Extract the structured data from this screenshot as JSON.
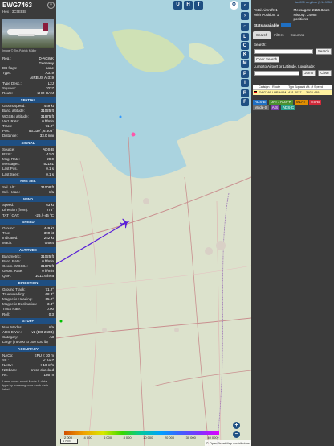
{
  "left_panel": {
    "callsign": "EWG7463",
    "hex_line": "Hex : 3C5EEB",
    "photo_credit": "Image © Tim-Patrick Müller",
    "close_glyph": "×",
    "basics": [
      {
        "k": "Reg.:",
        "v": "D-AGWK"
      },
      {
        "k": "",
        "v": "Germany"
      },
      {
        "k": "DB flags:",
        "v": "none"
      },
      {
        "k": "Type:",
        "v": "A319"
      },
      {
        "k": "",
        "v": "AIRBUS A-319"
      },
      {
        "k": "Type Desc.:",
        "v": "L2J"
      },
      {
        "k": "Squawk:",
        "v": "2037"
      },
      {
        "k": "Route:",
        "v": "LHR-HAM"
      }
    ],
    "spatial_title": "SPATIAL",
    "spatial": [
      {
        "k": "Groundspeed:",
        "v": "449 kt"
      },
      {
        "k": "Baro. altitude:",
        "v": "31025 ft"
      },
      {
        "k": "WGS84 altitude:",
        "v": "31875 ft"
      },
      {
        "k": "Vert. Rate:",
        "v": "0 ft/min"
      },
      {
        "k": "Track:",
        "v": "71.2°"
      },
      {
        "k": "Pos.:",
        "v": "53.330°, 6.808°"
      },
      {
        "k": "Distance:",
        "v": "33.0 nmi"
      }
    ],
    "signal_title": "SIGNAL",
    "signal": [
      {
        "k": "Source:",
        "v": "ADS-B"
      },
      {
        "k": "RSSI:",
        "v": "-11.0"
      },
      {
        "k": "Msg. Rate:",
        "v": "29.0"
      },
      {
        "k": "Messages:",
        "v": "52161"
      },
      {
        "k": "Last Pos.:",
        "v": "0.1 s"
      },
      {
        "k": "Last Seen:",
        "v": "0.1 s"
      }
    ],
    "fms_title": "FMS SEL",
    "fms": [
      {
        "k": "Sel. Alt.:",
        "v": "31008 ft"
      },
      {
        "k": "Sel. Head.:",
        "v": "n/a"
      }
    ],
    "wind_title": "WIND",
    "wind": [
      {
        "k": "Speed:",
        "v": "63 kt"
      },
      {
        "k": "Direction (from):",
        "v": "278°"
      },
      {
        "k": "TAT / OAT:",
        "v": "-26 / -46 °C"
      }
    ],
    "speed_title": "SPEED",
    "speed": [
      {
        "k": "Ground:",
        "v": "449 kt"
      },
      {
        "k": "True:",
        "v": "390 kt"
      },
      {
        "k": "Indicated:",
        "v": "242 kt"
      },
      {
        "k": "Mach:",
        "v": "0.664"
      }
    ],
    "altitude_title": "ALTITUDE",
    "altitude": [
      {
        "k": "Barometric:",
        "v": "31025 ft"
      },
      {
        "k": "Baro. Rate:",
        "v": "0 ft/min"
      },
      {
        "k": "Geom. WGS84:",
        "v": "31875 ft"
      },
      {
        "k": "Geom. Rate:",
        "v": "0 ft/min"
      },
      {
        "k": "QNH:",
        "v": "1013.6 hPa"
      }
    ],
    "direction_title": "DIRECTION",
    "direction": [
      {
        "k": "Ground Track:",
        "v": "71.2°"
      },
      {
        "k": "True Heading:",
        "v": "68.3°"
      },
      {
        "k": "Magnetic Heading:",
        "v": "65.2°"
      },
      {
        "k": "Magnetic Declination:",
        "v": "3.3°"
      },
      {
        "k": "Track Rate:",
        "v": "0.00"
      },
      {
        "k": "Roll:",
        "v": "0.3"
      }
    ],
    "stuff_title": "STUFF",
    "stuff": [
      {
        "k": "Nav. Modes:",
        "v": "n/a"
      },
      {
        "k": "ADS-B Ver.:",
        "v": "v2 (DO-260B)"
      },
      {
        "k": "Category:",
        "v": "A3"
      },
      {
        "k": "Large (75 000 to 300 000 lb)",
        "v": ""
      }
    ],
    "accuracy_title": "ACCURACY",
    "accuracy": [
      {
        "k": "NACp:",
        "v": "EPU < 30 m"
      },
      {
        "k": "SIL:",
        "v": "≤ 1e-7"
      },
      {
        "k": "NACv:",
        "v": "< 10 m/s"
      },
      {
        "k": "NICbaro:",
        "v": "cross-checked"
      },
      {
        "k": "Rc:",
        "v": "186 m"
      }
    ],
    "footer": "Learn more about Mode S data type by hovering over each data label."
  },
  "map": {
    "top_buttons": [
      "U",
      "H",
      "T"
    ],
    "zoom_in": "+",
    "zoom_out": "−",
    "scale_label": "1 NM",
    "altitude_labels": [
      "2 000",
      "4 000",
      "6 000",
      "8 000",
      "10 000",
      "20 000",
      "30 000",
      "40 000+"
    ],
    "attribution": "© OpenStreetMap contributors"
  },
  "side_buttons": [
    "L",
    "O",
    "K",
    "M",
    "P",
    "I",
    "R",
    "F"
  ],
  "right_panel": {
    "version_link": "tar1090 on github (3.14.1734)",
    "total_aircraft": "Total Aircraft: 1",
    "with_position": "With Position: 1",
    "messages": "Messages: 2155.8/sec",
    "history": "History: 24985 positions",
    "stats_available": "Stats available",
    "tabs": [
      "Search",
      "Filters",
      "Columns"
    ],
    "search_label": "Search:",
    "search_button": "Search",
    "clear_search_button": "Clear Search",
    "jump_label": "Jump to Airport or Latitude, Longitude:",
    "jump_button": "Jump",
    "clear_button": "Clear",
    "table_headers": [
      "",
      "Callsign",
      "Route",
      "Type",
      "Squawk",
      "Alt. (ft)",
      "Speed (kt)"
    ],
    "table_row": [
      "",
      "EWG7463",
      "LHR-HAM",
      "A319",
      "2037",
      "31025",
      "449"
    ],
    "filter_tags": [
      "ADS-B",
      "UAT / ADS-R",
      "MLAT",
      "TIS-B",
      "Mode-S",
      "AIS",
      "ADS-C"
    ]
  },
  "colors": {
    "panel_bg": "#3b3b3b",
    "section_bg": "#1f4f82",
    "map_bg": "#dce2cc",
    "water": "#aad3df",
    "aircraft": "#5a20d8",
    "selected_row": "#fff2a0"
  }
}
